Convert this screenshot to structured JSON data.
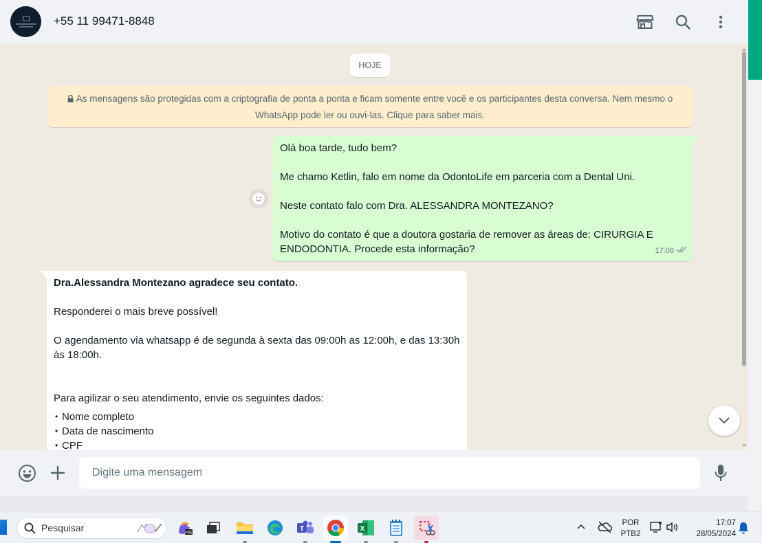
{
  "header": {
    "contact_name": "+55 11 99471-8848",
    "icons": [
      "catalog-store-icon",
      "search-icon",
      "more-options-icon"
    ]
  },
  "chat": {
    "date_label": "HOJE",
    "encryption_notice": "As mensagens são protegidas com a criptografia de ponta a ponta e ficam somente entre você e os participantes desta conversa. Nem mesmo o WhatsApp pode ler ou ouvi-las. Clique para saber mais.",
    "outgoing": {
      "lines": [
        "Olá boa tarde, tudo bem?",
        "Me chamo Ketlin, falo em nome da OdontoLife em parceria com a Dental Uni.",
        "Neste contato falo com Dra. ALESSANDRA MONTEZANO?",
        "Motivo do contato é que a doutora gostaria de remover as áreas de: CIRURGIA E ENDODONTIA. Procede esta informação?"
      ],
      "time": "17:06",
      "status": "read"
    },
    "incoming": {
      "title": "Dra.Alessandra Montezano agradece seu contato.",
      "line1": "Responderei o mais breve possível!",
      "line2": "O agendamento via whatsapp é de segunda à sexta das 09:00h as 12:00h, e das 13:30h às 18:00h.",
      "line3": "Para agilizar o seu atendimento, envie os seguintes dados:",
      "items": [
        "Nome completo",
        "Data de nascimento",
        "CPF"
      ]
    }
  },
  "composer": {
    "placeholder": "Digite uma mensagem"
  },
  "taskbar": {
    "search_label": "Pesquisar",
    "apps": [
      "copilot",
      "task-view",
      "file-explorer",
      "edge",
      "teams",
      "chrome",
      "excel",
      "notepad",
      "snipping-tool"
    ],
    "language_line1": "POR",
    "language_line2": "PTB2",
    "time": "17:07",
    "date": "28/05/2024"
  },
  "colors": {
    "outgoing_bubble": "#d9fdd3",
    "chat_background": "#efeae2",
    "encryption_notice_bg": "#ffeecd",
    "accent": "#00a884"
  }
}
